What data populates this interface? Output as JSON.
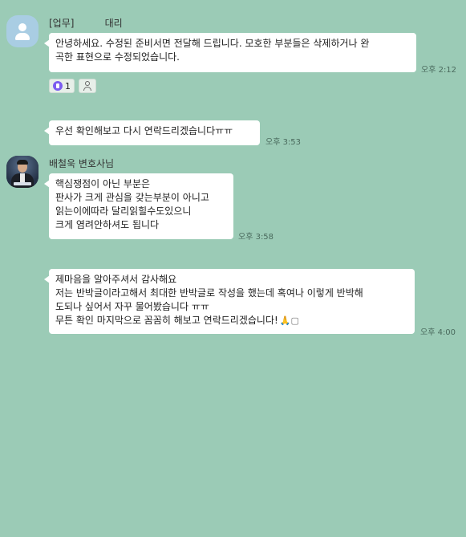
{
  "messages": {
    "group1": {
      "sender": "[업무]          대리",
      "bubble1": {
        "lines": [
          "안녕하세요. 수정된 준비서면 전달해 드립니다. 모호한 부분들은  삭제하거나 완",
          "곡한 표현으로 수정되었습니다."
        ],
        "time": "오후 2:12"
      },
      "reactions": {
        "like_count": "1",
        "like_icon": "thumbs-up-icon",
        "member_icon": "person-icon"
      },
      "bubble2": {
        "lines": [
          "우선 확인해보고 다시 연락드리겠습니다ㅠㅠ"
        ],
        "time": "오후 3:53"
      }
    },
    "group2": {
      "sender": "배철욱 변호사님",
      "bubble3": {
        "lines": [
          "핵심쟁점이 아닌 부분은",
          "판사가 크게 관심을 갖는부분이 아니고",
          "읽는이에따라 달리읽힐수도있으니",
          "크게 염려안하셔도 됩니다"
        ],
        "time": "오후 3:58"
      }
    },
    "group3": {
      "bubble4": {
        "lines": [
          "제마음을 알아주셔서 감사해요",
          "저는 반박글이라고해서 최대한 반박글로 작성을 했는데 혹여나 이렇게 반박해",
          "도되나 싶어서 자꾸 물어봤습니다 ㅠㅠ",
          "무튼 확인 마지막으로 꼼꼼히 해보고 연락드리겠습니다!"
        ],
        "emoji": "🙏▢",
        "time": "오후 4:00"
      }
    }
  }
}
